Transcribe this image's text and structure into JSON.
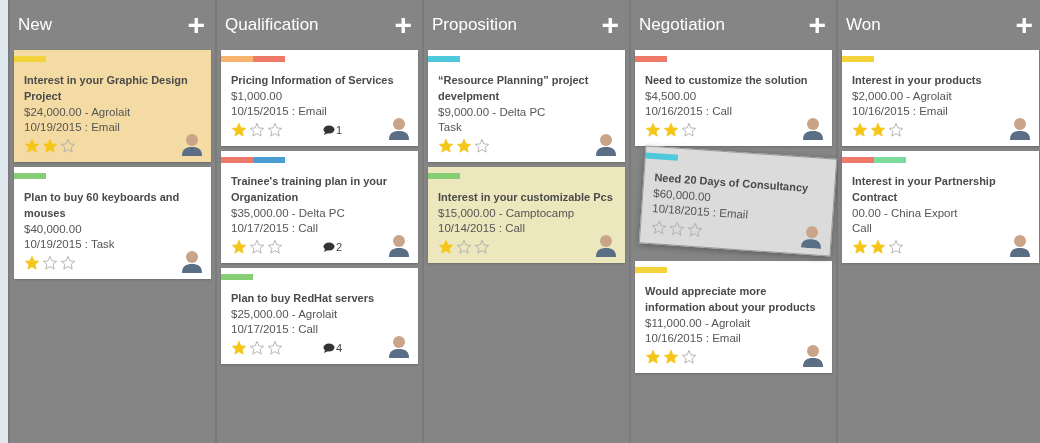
{
  "columns": [
    {
      "title": "New",
      "add_icon": "+",
      "cards": [
        {
          "tags": [
            {
              "color": "#f2d43a"
            }
          ],
          "title": "Interest in your Graphic Design Project",
          "lines": [
            "$24,000.00 - Agrolait",
            "10/19/2015 : Email"
          ],
          "stars": 2,
          "color": "#f4dba4",
          "placeholder_before": false
        },
        {
          "tags": [
            {
              "color": "#86cf74"
            }
          ],
          "title": "Plan to buy 60 keyboards and mouses",
          "lines": [
            "$40,000.00",
            "10/19/2015 : Task"
          ],
          "stars": 1,
          "placeholder_before": false
        }
      ]
    },
    {
      "title": "Qualification",
      "add_icon": "+",
      "cards": [
        {
          "tags": [
            {
              "color": "#f6b46c"
            },
            {
              "color": "#ef7a6a"
            }
          ],
          "title": "Pricing Information of Services",
          "lines": [
            "$1,000.00",
            "10/15/2015 : Email"
          ],
          "stars": 1,
          "comments": "1",
          "placeholder_before": false
        },
        {
          "tags": [
            {
              "color": "#ef7a6a"
            },
            {
              "color": "#4b9dd6"
            }
          ],
          "title": "Trainee's training plan in your Organization",
          "lines": [
            "$35,000.00 - Delta PC",
            "10/17/2015 : Call"
          ],
          "stars": 1,
          "comments": "2",
          "placeholder_before": false
        },
        {
          "tags": [
            {
              "color": "#86cf74"
            }
          ],
          "title": "Plan to buy RedHat servers",
          "lines": [
            "$25,000.00 - Agrolait",
            "10/17/2015 : Call"
          ],
          "stars": 1,
          "comments": "4",
          "placeholder_before": false
        }
      ]
    },
    {
      "title": "Proposition",
      "add_icon": "+",
      "cards": [
        {
          "tags": [
            {
              "color": "#4fc8dc"
            }
          ],
          "title": "“Resource Planning” project develpment",
          "lines": [
            "$9,000.00 - Delta PC",
            "Task"
          ],
          "stars": 2,
          "placeholder_before": false
        },
        {
          "tags": [
            {
              "color": "#86cf74"
            }
          ],
          "title": "Interest in your customizable Pcs",
          "lines": [
            "$15,000.00 - Camptocamp",
            "10/14/2015 : Call"
          ],
          "stars": 1,
          "color": "#ece7bd",
          "placeholder_before": false
        }
      ]
    },
    {
      "title": "Negotiation",
      "add_icon": "+",
      "cards": [
        {
          "tags": [
            {
              "color": "#ef7a6a"
            }
          ],
          "title": "Need to customize the solution",
          "lines": [
            "$4,500.00",
            "10/16/2015 : Call"
          ],
          "stars": 2,
          "placeholder_before": false
        },
        {
          "tags": [
            {
              "color": "#f2d43a"
            }
          ],
          "title": "Would appreciate more information about your products",
          "lines": [
            "$11,000.00 - Agrolait",
            "10/16/2015 : Email"
          ],
          "stars": 2,
          "placeholder_before": true
        }
      ]
    },
    {
      "title": "Won",
      "add_icon": "+",
      "cards": [
        {
          "tags": [
            {
              "color": "#f2d43a"
            }
          ],
          "title": "Interest in your products",
          "lines": [
            "$2,000.00 - Agrolait",
            "10/16/2015 : Email"
          ],
          "stars": 2,
          "placeholder_before": false
        },
        {
          "tags": [
            {
              "color": "#ef7a6a"
            },
            {
              "color": "#7ddb9b"
            }
          ],
          "title": "Interest in your Partnership Contract",
          "lines": [
            "00.00 - China Export",
            "Call"
          ],
          "stars": 2,
          "placeholder_before": false
        }
      ]
    }
  ],
  "dragged_card": {
    "tags": [
      {
        "color": "#4fc8dc"
      }
    ],
    "title": "Need 20 Days of Consultancy",
    "lines": [
      "$60,000.00",
      "10/18/2015 : Email"
    ],
    "stars": 0
  }
}
